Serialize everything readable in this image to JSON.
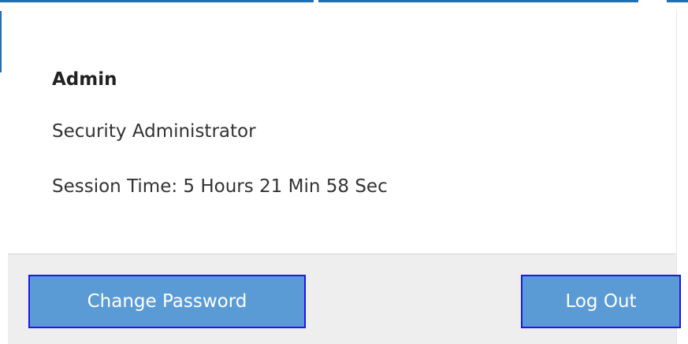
{
  "user": {
    "name": "Admin",
    "role": "Security Administrator",
    "session_time": "Session Time: 5 Hours 21 Min 58 Sec"
  },
  "actions": {
    "change_password_label": "Change Password",
    "logout_label": "Log Out"
  },
  "colors": {
    "accent": "#1f6fb5",
    "button_bg": "#5b9bd5",
    "button_border": "#1a1ae6",
    "footer_bg": "#eeeeee"
  }
}
